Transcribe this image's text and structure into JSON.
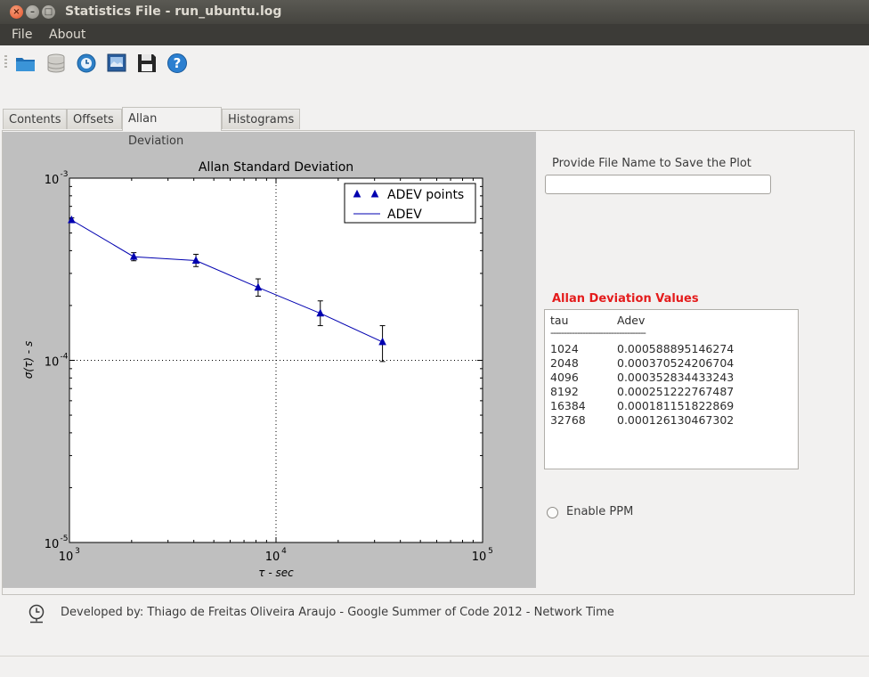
{
  "window": {
    "title": "Statistics File - run_ubuntu.log",
    "close": "×",
    "minimize": "–",
    "maximize": "□"
  },
  "menu": {
    "file": "File",
    "about": "About"
  },
  "toolbar": {
    "icons": [
      "open-folder-icon",
      "database-icon",
      "refresh-clock-icon",
      "image-icon",
      "save-disk-icon",
      "help-icon"
    ]
  },
  "tabs": {
    "contents": "Contents",
    "offsets": "Offsets",
    "allan": "Allan Deviation",
    "histograms": "Histograms"
  },
  "chart_data": {
    "type": "scatter",
    "title": "Allan Standard Deviation",
    "xlabel": "τ - sec",
    "ylabel": "σ(τ) - s",
    "xscale": "log",
    "yscale": "log",
    "xlim": [
      1000,
      100000
    ],
    "ylim": [
      1e-05,
      0.001
    ],
    "xticks": [
      {
        "base": "10",
        "exp": "3"
      },
      {
        "base": "10",
        "exp": "4"
      },
      {
        "base": "10",
        "exp": "5"
      }
    ],
    "yticks": [
      {
        "base": "10",
        "exp": "-3"
      },
      {
        "base": "10",
        "exp": "-4"
      },
      {
        "base": "10",
        "exp": "-5"
      }
    ],
    "grid": true,
    "legend_position": "top-right",
    "legend": {
      "points": "ADEV points",
      "line": "ADEV"
    },
    "color": "#0000b0",
    "x": [
      1024,
      2048,
      4096,
      8192,
      16384,
      32768
    ],
    "y": [
      0.000588895146274,
      0.000370524206704,
      0.000352834433243,
      0.000251222767487,
      0.000181151822869,
      0.000126130467302
    ],
    "err_low": [
      0.00057,
      0.000352,
      0.000327,
      0.000225,
      0.000155,
      9.85e-05
    ],
    "err_high": [
      0.000605,
      0.00039,
      0.000382,
      0.00028,
      0.000212,
      0.000155
    ]
  },
  "save": {
    "label": "Provide File Name to Save the Plot",
    "value": ""
  },
  "values": {
    "title": "Allan Deviation Values",
    "header_tau": "tau",
    "header_adev": "Adev",
    "separator": "------------------------------------",
    "rows": [
      {
        "tau": "1024",
        "adev": "0.000588895146274"
      },
      {
        "tau": "2048",
        "adev": "0.000370524206704"
      },
      {
        "tau": "4096",
        "adev": "0.000352834433243"
      },
      {
        "tau": "8192",
        "adev": "0.000251222767487"
      },
      {
        "tau": "16384",
        "adev": "0.000181151822869"
      },
      {
        "tau": "32768",
        "adev": "0.000126130467302"
      }
    ]
  },
  "ppm": {
    "label": "Enable PPM",
    "checked": false
  },
  "footer": {
    "text": "Developed by: Thiago de Freitas Oliveira Araujo - Google Summer of Code 2012 - Network Time"
  }
}
